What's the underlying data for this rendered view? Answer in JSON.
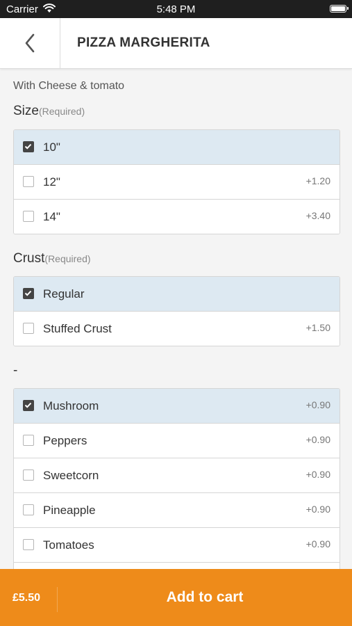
{
  "status_bar": {
    "carrier": "Carrier",
    "time": "5:48 PM"
  },
  "header": {
    "title": "PIZZA MARGHERITA"
  },
  "description": "With Cheese & tomato",
  "sections": {
    "size": {
      "title": "Size",
      "required": "(Required)",
      "options": [
        {
          "label": "10\"",
          "price": "",
          "checked": true
        },
        {
          "label": "12\"",
          "price": "+1.20",
          "checked": false
        },
        {
          "label": "14\"",
          "price": "+3.40",
          "checked": false
        }
      ]
    },
    "crust": {
      "title": "Crust",
      "required": "(Required)",
      "options": [
        {
          "label": "Regular",
          "price": "",
          "checked": true
        },
        {
          "label": "Stuffed Crust",
          "price": "+1.50",
          "checked": false
        }
      ]
    },
    "toppings": {
      "title": "-",
      "options": [
        {
          "label": "Mushroom",
          "price": "+0.90",
          "checked": true
        },
        {
          "label": "Peppers",
          "price": "+0.90",
          "checked": false
        },
        {
          "label": "Sweetcorn",
          "price": "+0.90",
          "checked": false
        },
        {
          "label": "Pineapple",
          "price": "+0.90",
          "checked": false
        },
        {
          "label": "Tomatoes",
          "price": "+0.90",
          "checked": false
        },
        {
          "label": "",
          "price": "",
          "checked": false
        }
      ]
    }
  },
  "footer": {
    "total": "£5.50",
    "add_to_cart_label": "Add to cart"
  },
  "colors": {
    "accent": "#ee8b1a",
    "selected_row": "#dde9f2",
    "status_bar": "#1f1f1f"
  },
  "icons": {
    "back": "chevron-left-icon",
    "wifi": "wifi-icon",
    "battery": "battery-icon",
    "check": "checkmark-icon"
  }
}
